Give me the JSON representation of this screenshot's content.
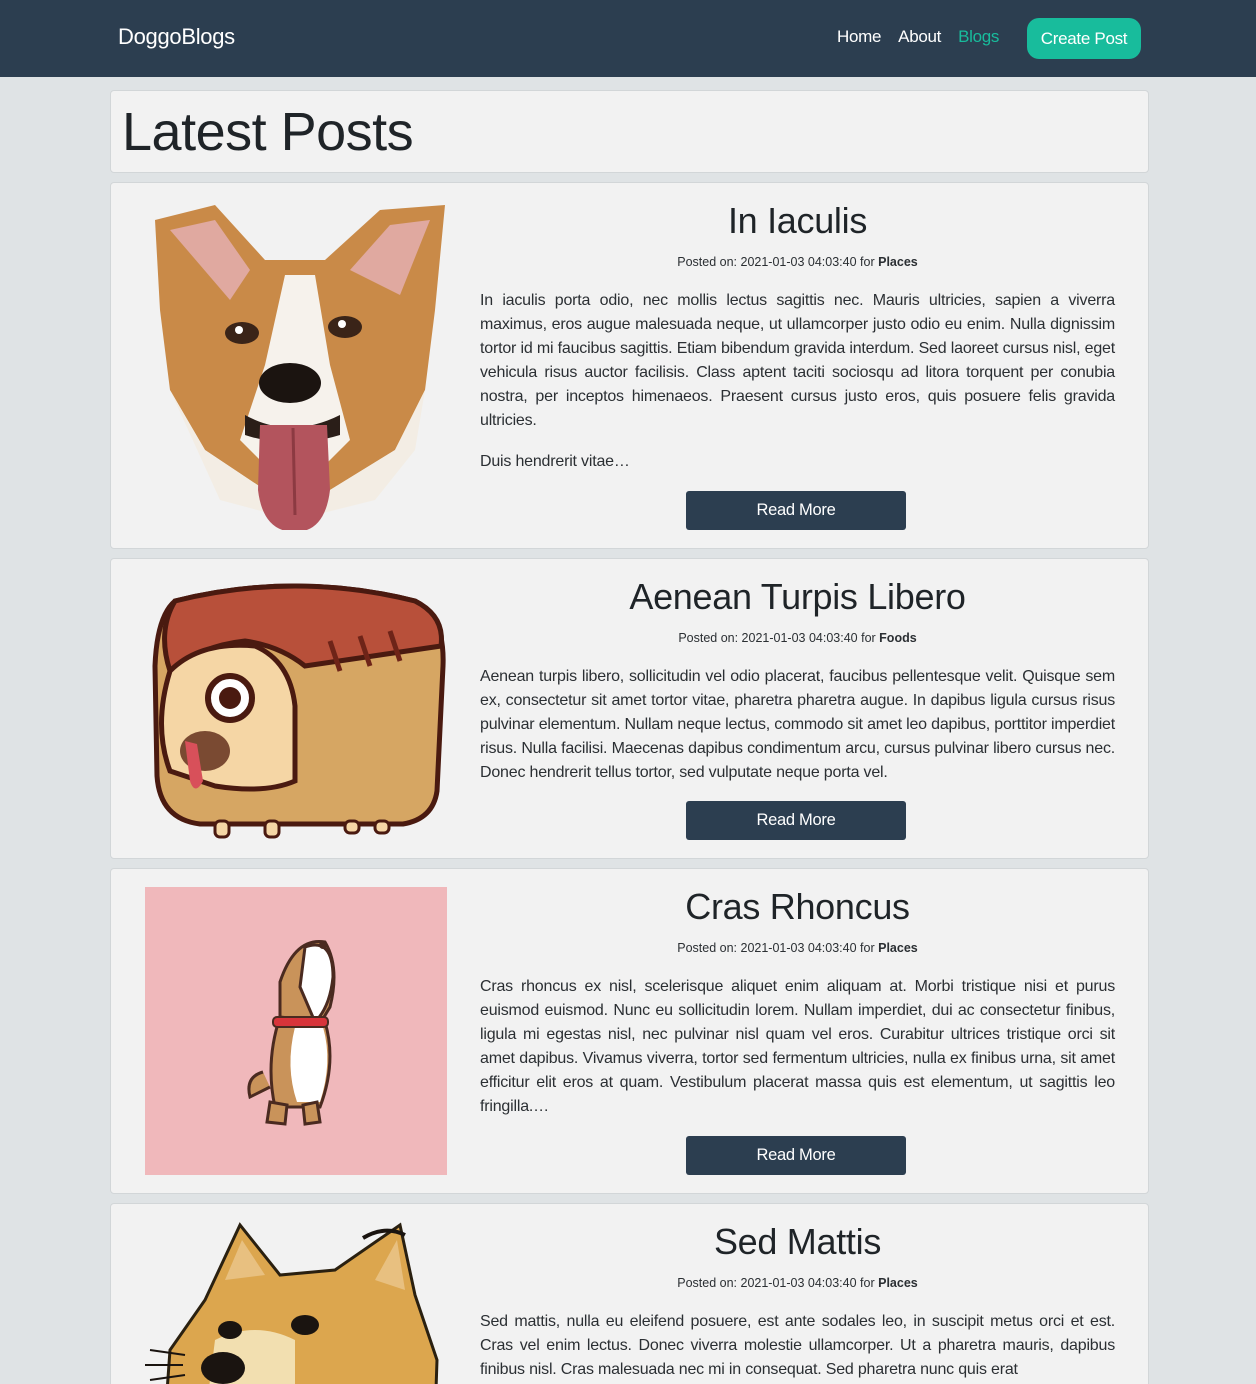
{
  "navbar": {
    "brand": "DoggoBlogs",
    "links": [
      {
        "label": "Home"
      },
      {
        "label": "About"
      },
      {
        "label": "Blogs",
        "active": true
      }
    ],
    "create_button": "Create Post"
  },
  "page": {
    "title": "Latest Posts"
  },
  "colors": {
    "navbar_bg": "#2c3e50",
    "accent": "#18bc9c",
    "card_bg": "#f2f2f2",
    "page_bg": "#dfe3e5"
  },
  "posts": [
    {
      "title": "In Iaculis",
      "meta_prefix": "Posted on: 2021-01-03 04:03:40 for",
      "category": "Places",
      "image": "corgi-face-illustration",
      "paragraphs": [
        "In iaculis porta odio, nec mollis lectus sagittis nec. Mauris ultricies, sapien a viverra maximus, eros augue malesuada neque, ut ullamcorper justo odio eu enim. Nulla dignissim tortor id mi faucibus sagittis. Etiam bibendum gravida interdum. Sed laoreet cursus nisl, eget vehicula risus auctor facilisis. Class aptent taciti sociosqu ad litora torquent per conubia nostra, per inceptos himenaeos. Praesent cursus justo eros, quis posuere felis gravida ultricies.",
        "Duis hendrerit vitae…"
      ],
      "button": "Read More"
    },
    {
      "title": "Aenean Turpis Libero",
      "meta_prefix": "Posted on: 2021-01-03 04:03:40 for",
      "category": "Foods",
      "image": "pug-in-bread-loaf-illustration",
      "paragraphs": [
        "Aenean turpis libero, sollicitudin vel odio placerat, faucibus pellentesque velit. Quisque sem ex, consectetur sit amet tortor vitae, pharetra pharetra augue. In dapibus ligula cursus risus pulvinar elementum. Nullam neque lectus, commodo sit amet leo dapibus, porttitor imperdiet risus. Nulla facilisi. Maecenas dapibus condimentum arcu, cursus pulvinar libero cursus nec. Donec hendrerit tellus tortor, sed vulputate neque porta vel."
      ],
      "button": "Read More"
    },
    {
      "title": "Cras Rhoncus",
      "meta_prefix": "Posted on: 2021-01-03 04:03:40 for",
      "category": "Places",
      "image": "cartoon-puppy-on-pink-illustration",
      "paragraphs": [
        "Cras rhoncus ex nisl, scelerisque aliquet enim aliquam at. Morbi tristique nisi et purus euismod euismod. Nunc eu sollicitudin lorem. Nullam imperdiet, dui ac consectetur finibus, ligula mi egestas nisl, nec pulvinar nisl quam vel eros. Curabitur ultrices tristique orci sit amet dapibus. Vivamus viverra, tortor sed fermentum ultricies, nulla ex finibus urna, sit amet efficitur elit eros at quam. Vestibulum placerat massa quis est elementum, ut sagittis leo fringilla.…"
      ],
      "button": "Read More"
    },
    {
      "title": "Sed Mattis",
      "meta_prefix": "Posted on: 2021-01-03 04:03:40 for",
      "category": "Places",
      "image": "shiba-doge-illustration",
      "paragraphs": [
        "Sed mattis, nulla eu eleifend posuere, est ante sodales leo, in suscipit metus orci et est. Cras vel enim lectus. Donec viverra molestie ullamcorper. Ut a pharetra mauris, dapibus finibus nisl. Cras malesuada nec mi in consequat. Sed pharetra nunc quis erat"
      ]
    }
  ]
}
